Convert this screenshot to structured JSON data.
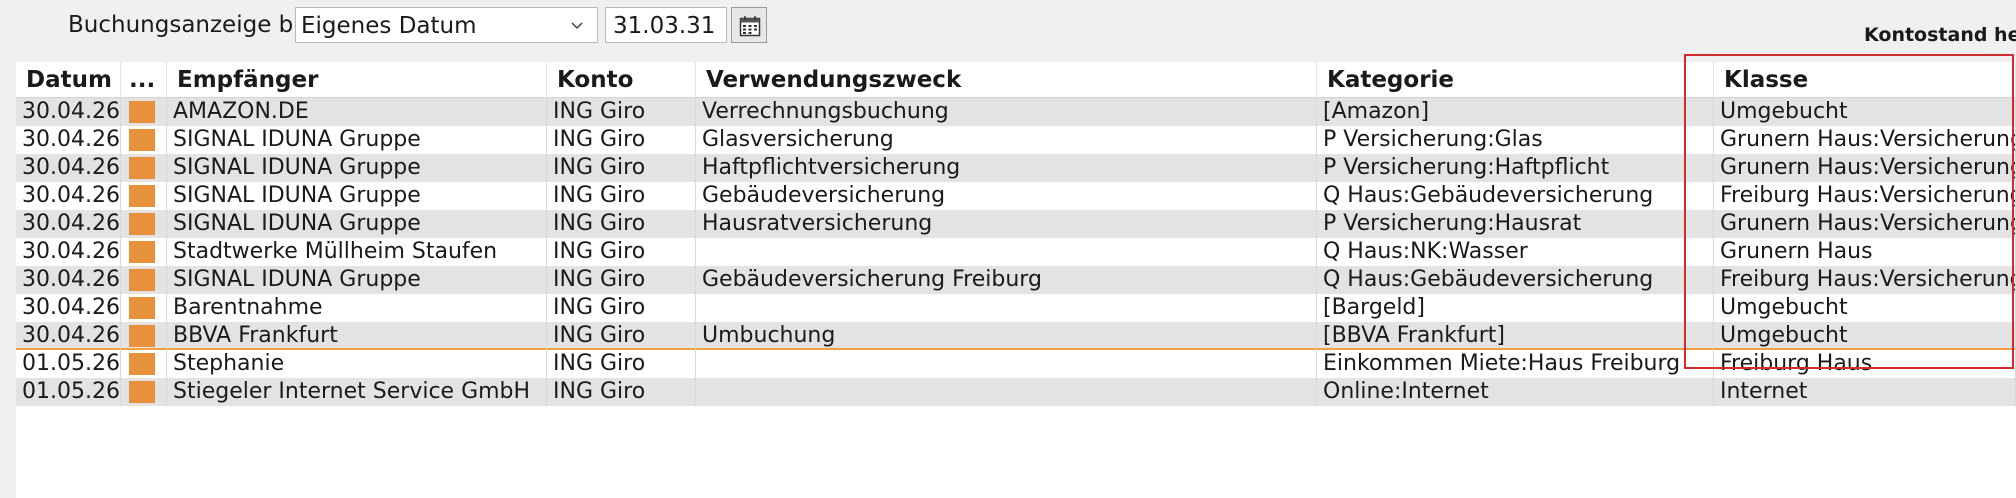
{
  "toolbar": {
    "label": "Buchungsanzeige bis",
    "range_select": "Eigenes Datum",
    "date_value": "31.03.31"
  },
  "kontostand_label": "Kontostand he",
  "columns": [
    "Datum",
    "...",
    "Empfänger",
    "Konto",
    "Verwendungszweck",
    "Kategorie",
    "Klasse"
  ],
  "rows": [
    {
      "datum": "30.04.26",
      "empfaenger": "AMAZON.DE",
      "konto": "ING Giro",
      "zweck": "Verrechnungsbuchung",
      "kategorie": "[Amazon]",
      "klasse": "Umgebucht"
    },
    {
      "datum": "30.04.26",
      "empfaenger": "SIGNAL IDUNA Gruppe",
      "konto": "ING Giro",
      "zweck": "Glasversicherung",
      "kategorie": "P Versicherung:Glas",
      "klasse": "Grunern Haus:Versicherung"
    },
    {
      "datum": "30.04.26",
      "empfaenger": "SIGNAL IDUNA Gruppe",
      "konto": "ING Giro",
      "zweck": "Haftpflichtversicherung",
      "kategorie": "P Versicherung:Haftpflicht",
      "klasse": "Grunern Haus:Versicherung"
    },
    {
      "datum": "30.04.26",
      "empfaenger": "SIGNAL IDUNA Gruppe",
      "konto": "ING Giro",
      "zweck": "Gebäudeversicherung",
      "kategorie": "Q Haus:Gebäudeversicherung",
      "klasse": "Freiburg Haus:Versicherung"
    },
    {
      "datum": "30.04.26",
      "empfaenger": "SIGNAL IDUNA Gruppe",
      "konto": "ING Giro",
      "zweck": "Hausratversicherung",
      "kategorie": "P Versicherung:Hausrat",
      "klasse": "Grunern Haus:Versicherung"
    },
    {
      "datum": "30.04.26",
      "empfaenger": "Stadtwerke Müllheim Staufen",
      "konto": "ING Giro",
      "zweck": "",
      "kategorie": "Q Haus:NK:Wasser",
      "klasse": "Grunern Haus"
    },
    {
      "datum": "30.04.26",
      "empfaenger": "SIGNAL IDUNA Gruppe",
      "konto": "ING Giro",
      "zweck": "Gebäudeversicherung Freiburg",
      "kategorie": "Q Haus:Gebäudeversicherung",
      "klasse": "Freiburg Haus:Versicherung"
    },
    {
      "datum": "30.04.26",
      "empfaenger": "Barentnahme",
      "konto": "ING Giro",
      "zweck": "",
      "kategorie": "[Bargeld]",
      "klasse": "Umgebucht"
    },
    {
      "datum": "30.04.26",
      "empfaenger": "BBVA Frankfurt",
      "konto": "ING Giro",
      "zweck": "Umbuchung",
      "kategorie": "[BBVA Frankfurt]",
      "klasse": "Umgebucht"
    },
    {
      "datum": "01.05.26",
      "empfaenger": "Stephanie",
      "konto": "ING Giro",
      "zweck": "",
      "kategorie": "Einkommen Miete:Haus Freiburg",
      "klasse": "Freiburg Haus"
    },
    {
      "datum": "01.05.26",
      "empfaenger": "Stiegeler Internet Service GmbH",
      "konto": "ING Giro",
      "zweck": "",
      "kategorie": "Online:Internet",
      "klasse": "Internet"
    }
  ],
  "colors": {
    "category_swatch": "#e8913c",
    "highlight_border": "#d12b2b",
    "separator_line": "#f0a040"
  },
  "icons": {
    "dropdown": "chevron-down-icon",
    "date_picker": "calendar-icon"
  }
}
